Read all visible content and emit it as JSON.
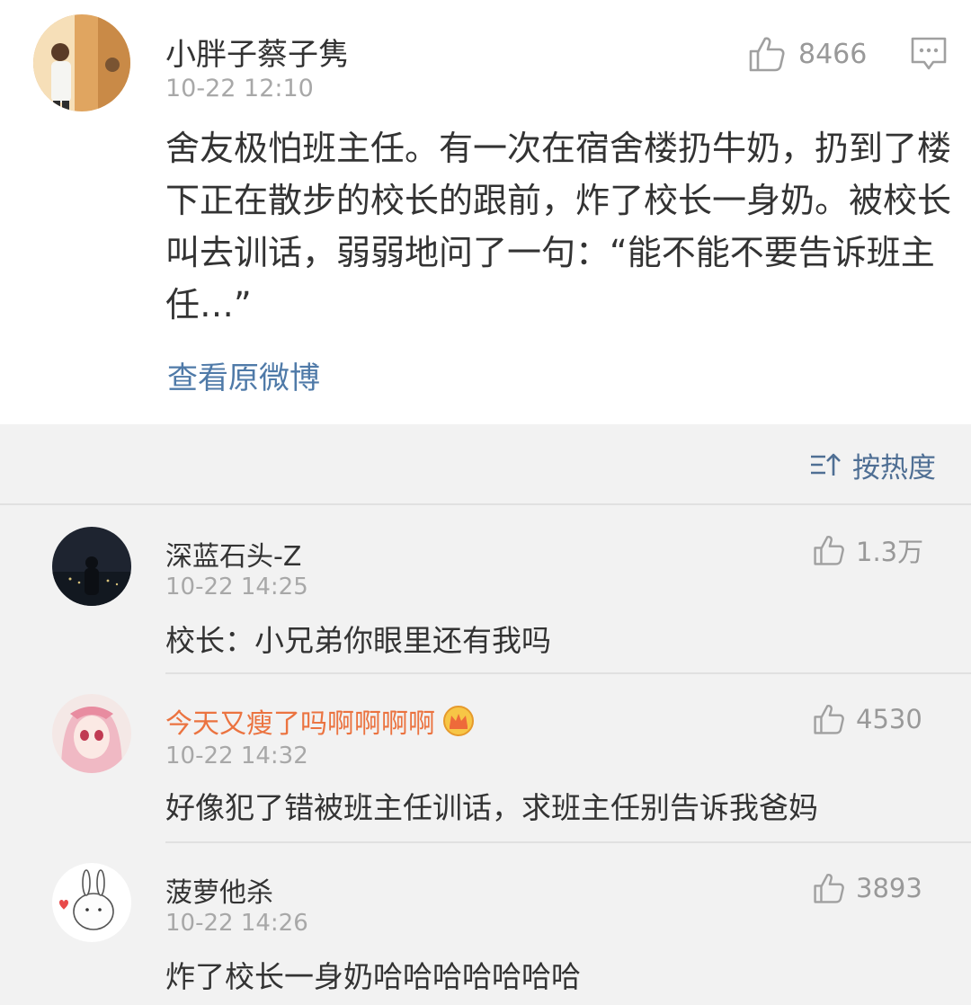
{
  "post": {
    "author": "小胖子蔡子隽",
    "time": "10-22 12:10",
    "likes": "8466",
    "text": "舍友极怕班主任。有一次在宿舍楼扔牛奶，扔到了楼下正在散步的校长的跟前，炸了校长一身奶。被校长叫去训话，弱弱地问了一句：“能不能不要告诉班主任…”",
    "view_original": "查看原微博"
  },
  "sort": {
    "label": "按热度"
  },
  "comments": [
    {
      "name": "深蓝石头-Z",
      "time": "10-22 14:25",
      "likes": "1.3万",
      "text": "校长：小兄弟你眼里还有我吗"
    },
    {
      "name": "今天又瘦了吗啊啊啊啊",
      "time": "10-22 14:32",
      "likes": "4530",
      "text": "好像犯了错被班主任训话，求班主任别告诉我爸妈"
    },
    {
      "name": "菠萝他杀",
      "time": "10-22 14:26",
      "likes": "3893",
      "text": "炸了校长一身奶哈哈哈哈哈哈哈"
    }
  ],
  "icons": {
    "like": "thumbs-up-icon",
    "comment": "comment-icon",
    "sort": "sort-icon",
    "vip": "crown-badge-icon"
  },
  "colors": {
    "link": "#4f7aa8",
    "vip_name": "#eb7340",
    "muted": "#a8a8a8",
    "background": "#f2f2f2"
  }
}
